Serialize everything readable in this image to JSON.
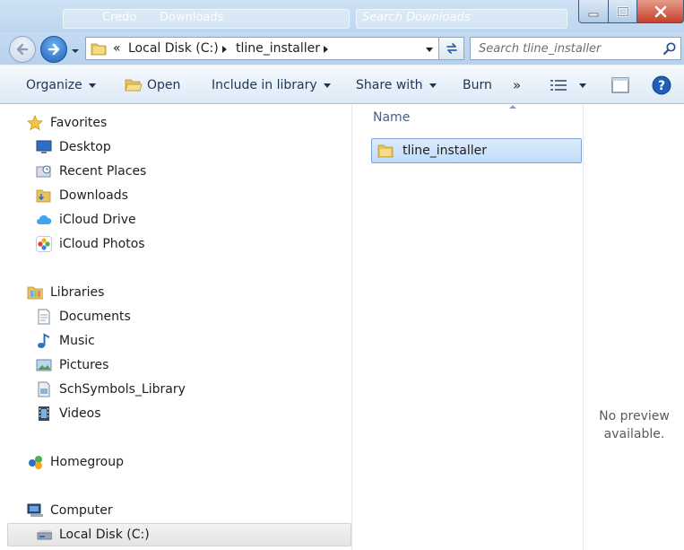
{
  "window": {
    "ghost_breadcrumb": "Credo",
    "ghost_folder": "Downloads",
    "ghost_search": "Search Downloads"
  },
  "address": {
    "overflow": "«",
    "crumbs": [
      "Local Disk (C:)",
      "tline_installer"
    ],
    "search_placeholder": "Search tline_installer"
  },
  "toolbar": {
    "organize": "Organize",
    "open": "Open",
    "include_in_library": "Include in library",
    "share_with": "Share with",
    "burn": "Burn",
    "more": "»"
  },
  "sidebar": {
    "favorites": {
      "label": "Favorites",
      "items": [
        "Desktop",
        "Recent Places",
        "Downloads",
        "iCloud Drive",
        "iCloud Photos"
      ]
    },
    "libraries": {
      "label": "Libraries",
      "items": [
        "Documents",
        "Music",
        "Pictures",
        "SchSymbols_Library",
        "Videos"
      ]
    },
    "homegroup": "Homegroup",
    "computer": {
      "label": "Computer",
      "items": [
        "Local Disk (C:)"
      ]
    }
  },
  "filelist": {
    "column_name": "Name",
    "rows": [
      {
        "name": "tline_installer"
      }
    ]
  },
  "preview": {
    "line1": "No preview",
    "line2": "available."
  },
  "colors": {
    "accent": "#3a7bd5",
    "selection": "#c1dcfa",
    "frame": "#bcd6ef"
  }
}
